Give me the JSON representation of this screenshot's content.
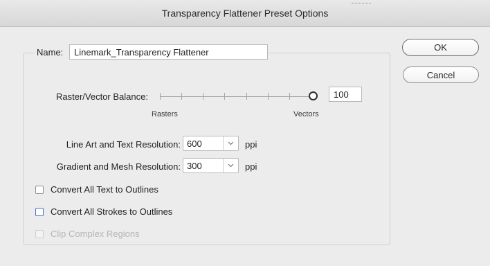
{
  "window": {
    "title": "Transparency Flattener Preset Options"
  },
  "name_field": {
    "label": "Name:",
    "value": "Linemark_Transparency Flattener"
  },
  "buttons": {
    "ok_label": "OK",
    "cancel_label": "Cancel"
  },
  "raster_vector_balance": {
    "label": "Raster/Vector Balance:",
    "value": "100",
    "slider_fraction": 1.0,
    "left_label": "Rasters",
    "right_label": "Vectors"
  },
  "line_art_resolution": {
    "label": "Line Art and Text Resolution:",
    "value": "600",
    "unit": "ppi"
  },
  "gradient_resolution": {
    "label": "Gradient and Mesh Resolution:",
    "value": "300",
    "unit": "ppi"
  },
  "checkboxes": [
    {
      "label": "Convert All Text to Outlines",
      "checked": false,
      "enabled": true
    },
    {
      "label": "Convert All Strokes to Outlines",
      "checked": false,
      "enabled": true,
      "focused": true
    },
    {
      "label": "Clip Complex Regions",
      "checked": false,
      "enabled": false
    }
  ],
  "colors": {
    "focus_ring": "#4a6fd3",
    "disabled_text": "#b5b5b5",
    "dialog_bg": "#ececec"
  }
}
